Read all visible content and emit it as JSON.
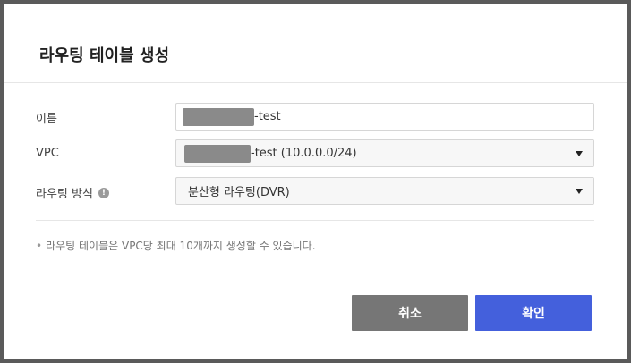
{
  "dialog": {
    "title": "라우팅 테이블 생성",
    "fields": {
      "name": {
        "label": "이름",
        "value_suffix": "-test"
      },
      "vpc": {
        "label": "VPC",
        "value_suffix": "-test (10.0.0.0/24)",
        "icon": "chevron-down-icon"
      },
      "routing": {
        "label": "라우팅 방식",
        "info_icon": "info-icon",
        "info_glyph": "!",
        "value": "분산형 라우팅(DVR)",
        "icon": "chevron-down-icon"
      }
    },
    "note": "라우팅 테이블은 VPC당 최대 10개까지 생성할 수 있습니다.",
    "note_bullet": "•",
    "buttons": {
      "cancel": "취소",
      "ok": "확인"
    },
    "colors": {
      "ok": "#4460dc",
      "cancel": "#767676"
    }
  }
}
